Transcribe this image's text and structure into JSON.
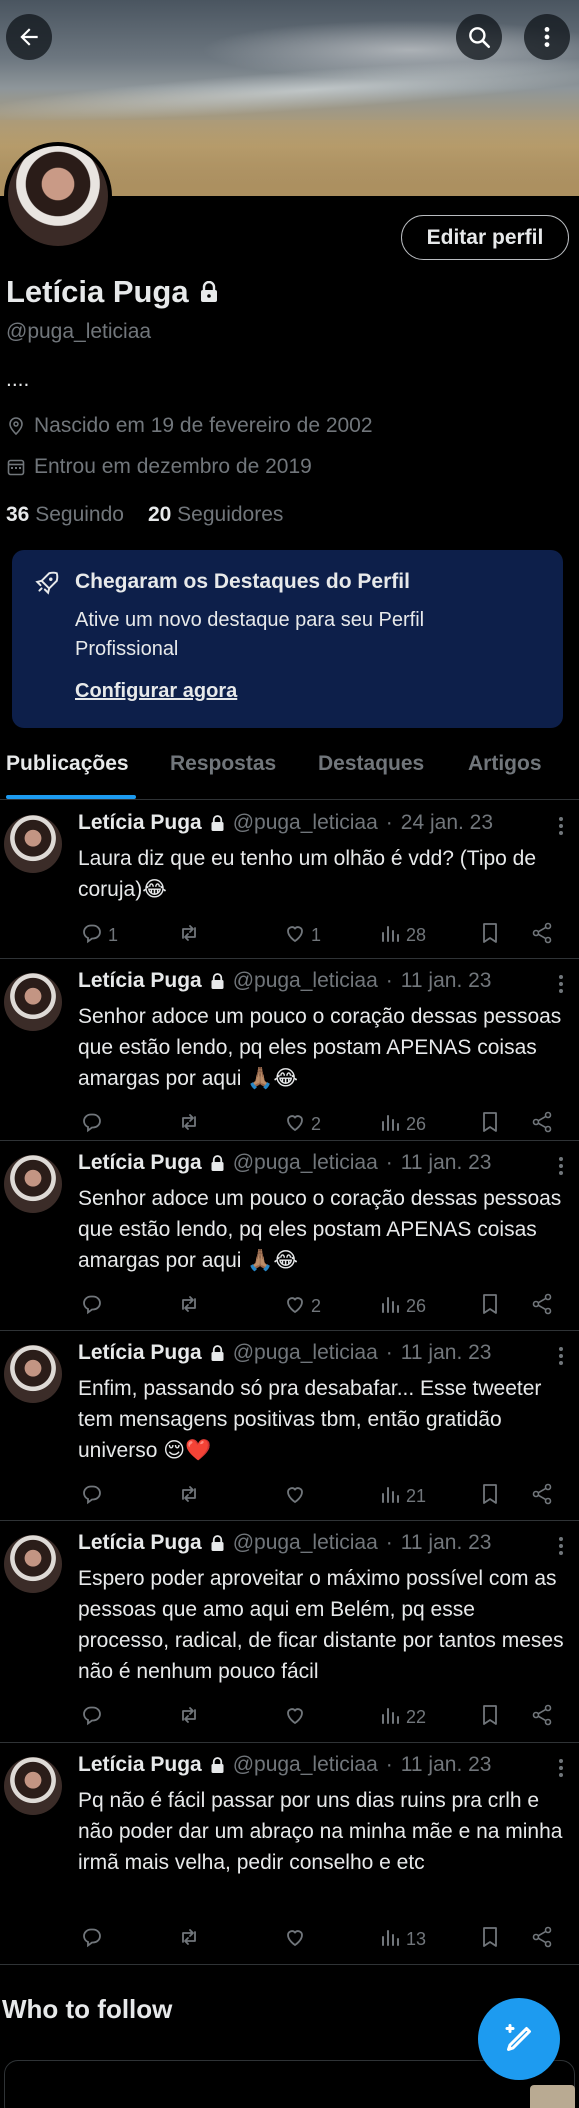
{
  "header": {
    "back_icon": "arrow-left-icon",
    "search_icon": "search-icon",
    "more_icon": "more-vertical-icon"
  },
  "profile": {
    "name": "Letícia Puga",
    "handle": "@puga_leticiaa",
    "bio": "....",
    "birth": "Nascido em 19 de fevereiro de 2002",
    "joined": "Entrou em dezembro de 2019",
    "following_count": "36",
    "following_label": "Seguindo",
    "followers_count": "20",
    "followers_label": "Seguidores",
    "edit_label": "Editar perfil"
  },
  "promo": {
    "title": "Chegaram os Destaques do Perfil",
    "description": "Ative um novo destaque para seu Perfil Profissional",
    "link": "Configurar agora"
  },
  "tabs": [
    {
      "label": "Publicações"
    },
    {
      "label": "Respostas"
    },
    {
      "label": "Destaques"
    },
    {
      "label": "Artigos"
    }
  ],
  "tweets": [
    {
      "name": "Letícia Puga",
      "handle": "@puga_leticiaa",
      "dot": "·",
      "date": "24 jan. 23",
      "text": "Laura diz que eu tenho um olhão é vdd? (Tipo de coruja)😂",
      "replies": "1",
      "retweets": "",
      "likes": "1",
      "views": "28"
    },
    {
      "name": "Letícia Puga",
      "handle": "@puga_leticiaa",
      "dot": "·",
      "date": "11 jan. 23",
      "text": "Senhor adoce um pouco o coração dessas pessoas que estão lendo, pq eles postam APENAS coisas amargas por aqui 🙏🏽😂",
      "replies": "",
      "retweets": "",
      "likes": "2",
      "views": "26"
    },
    {
      "name": "Letícia Puga",
      "handle": "@puga_leticiaa",
      "dot": "·",
      "date": "11 jan. 23",
      "text": "Senhor adoce um pouco o coração dessas pessoas que estão lendo, pq eles postam APENAS coisas amargas por aqui 🙏🏽😂",
      "replies": "",
      "retweets": "",
      "likes": "2",
      "views": "26"
    },
    {
      "name": "Letícia Puga",
      "handle": "@puga_leticiaa",
      "dot": "·",
      "date": "11 jan. 23",
      "text": "Enfim, passando só pra desabafar... Esse tweeter tem mensagens positivas tbm, então gratidão universo 😌❤️",
      "replies": "",
      "retweets": "",
      "likes": "",
      "views": "21"
    },
    {
      "name": "Letícia Puga",
      "handle": "@puga_leticiaa",
      "dot": "·",
      "date": "11 jan. 23",
      "text": "Espero poder aproveitar o máximo possível com as pessoas que amo aqui em Belém, pq esse processo, radical, de ficar distante por tantos meses não é nenhum pouco fácil",
      "replies": "",
      "retweets": "",
      "likes": "",
      "views": "22"
    },
    {
      "name": "Letícia Puga",
      "handle": "@puga_leticiaa",
      "dot": "·",
      "date": "11 jan. 23",
      "text": "Pq não é fácil passar por uns dias ruins pra crlh e não poder dar um abraço na minha mãe e na minha irmã mais velha, pedir conselho e etc",
      "replies": "",
      "retweets": "",
      "likes": "",
      "views": "13"
    }
  ],
  "who_to_follow": "Who to follow",
  "compose_icon": "compose-post-icon",
  "colors": {
    "accent": "#1d9bf0",
    "promo_bg": "#0d1f4a",
    "muted": "#71767b",
    "text": "#e7e9ea"
  }
}
